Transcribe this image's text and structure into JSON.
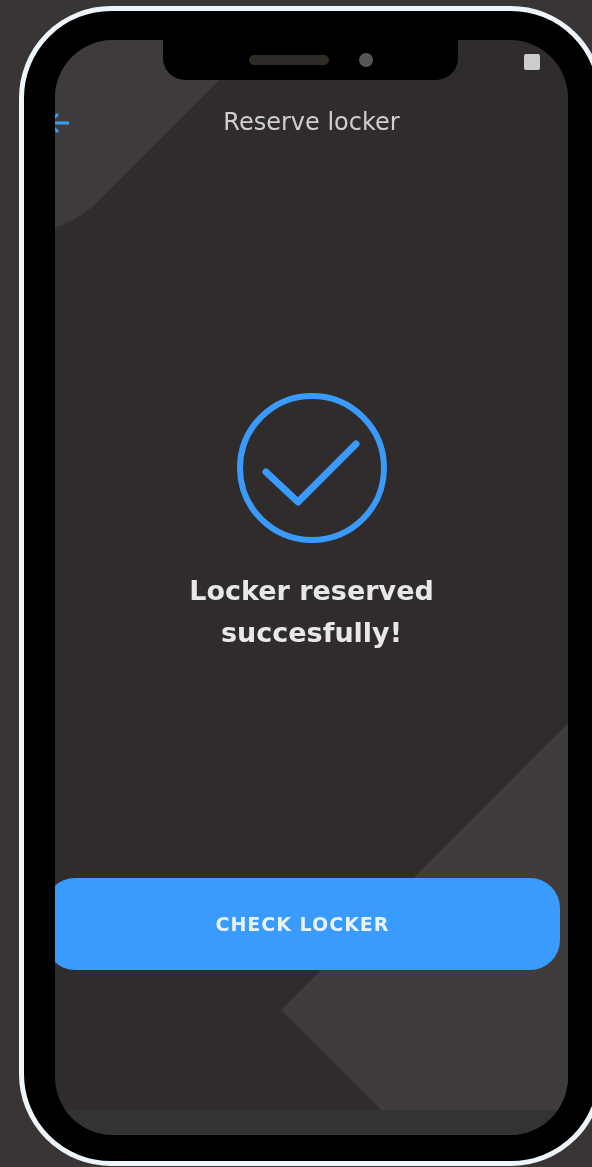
{
  "screen": {
    "title": "Reserve locker",
    "message": "Locker reserved succesfully!",
    "button": "CHECK LOCKER"
  }
}
